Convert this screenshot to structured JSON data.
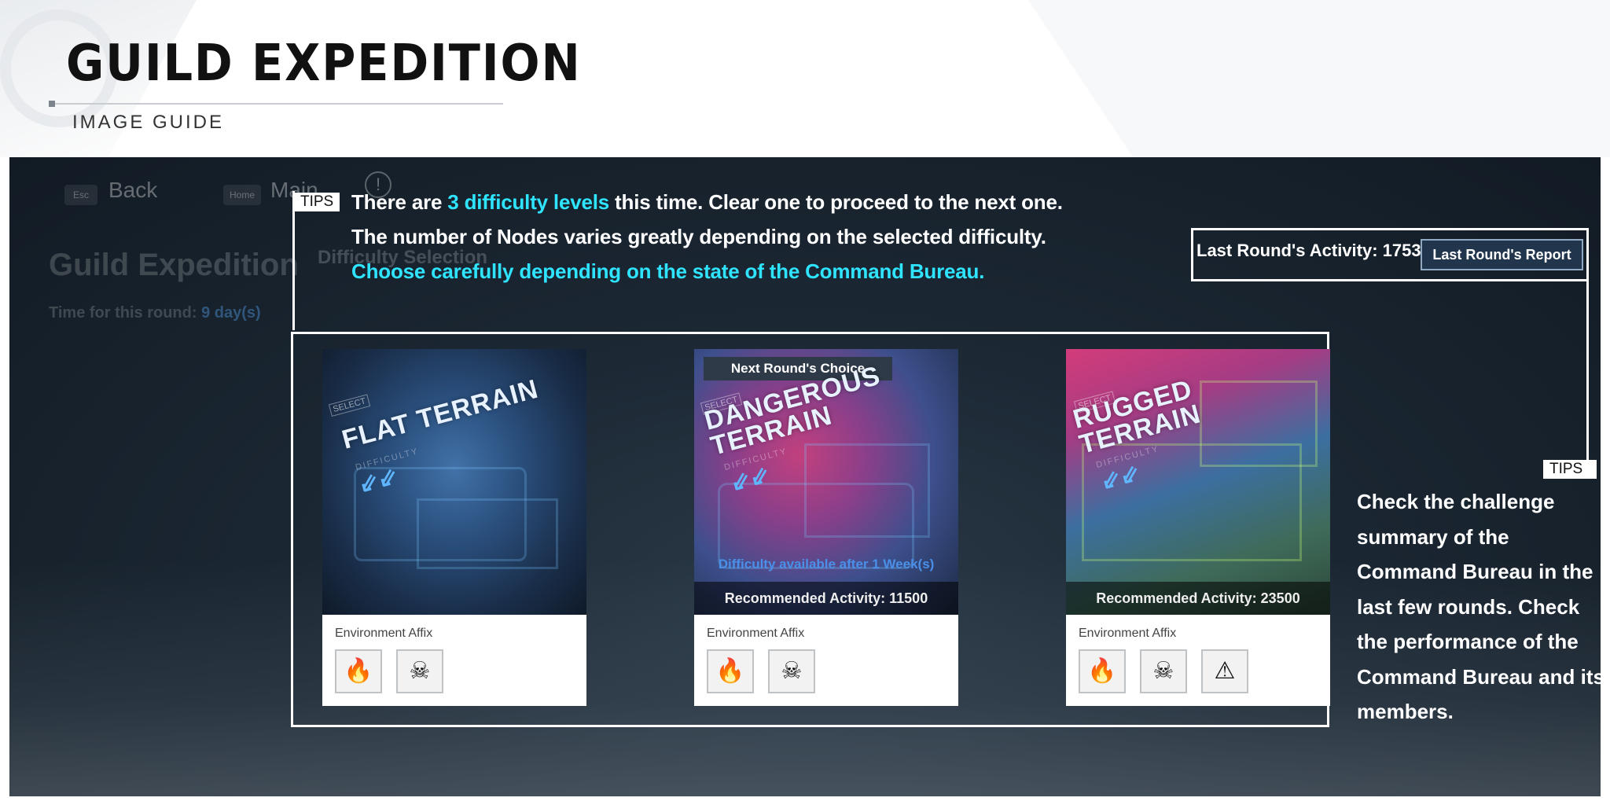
{
  "guide": {
    "title": "GUILD EXPEDITION",
    "subtitle": "IMAGE GUIDE"
  },
  "game_ui": {
    "esc_key": "Esc",
    "back_label": "Back",
    "home_key": "Home",
    "main_label": "Main",
    "info_icon": "!",
    "screen_title": "Guild Expedition",
    "time_label": "Time for this round:",
    "time_value": "9 day(s)",
    "section_label": "Difficulty Selection"
  },
  "tips": {
    "tag": "TIPS",
    "line1_pre": "There are ",
    "line1_highlight": "3 difficulty levels",
    "line1_post": " this time. Clear one to proceed to the next one.",
    "line2": "The number of Nodes varies greatly depending on the selected difficulty.",
    "line3": "Choose carefully depending on the state of the Command Bureau.",
    "side_text": "Check the challenge summary of the Command Bureau in the last few rounds. Check the performance of the Command Bureau and its members."
  },
  "last_round": {
    "activity_text": "Last Round's Activity: 1753",
    "report_button": "Last Round's Report"
  },
  "cards": [
    {
      "select_tag": "SELECT",
      "name_line1": "FLAT TERRAIN",
      "name_line2": "",
      "difficulty_word": "DIFFICULTY",
      "arrows": "⇙⇙",
      "recommended": "",
      "env_label": "Environment Affix",
      "affixes": [
        "fire-icon",
        "beast-icon"
      ]
    },
    {
      "badge": "Next Round's Choice",
      "select_tag": "SELECT",
      "name_line1": "DANGEROUS",
      "name_line2": "TERRAIN",
      "difficulty_word": "DIFFICULTY",
      "arrows": "⇙⇙",
      "availability": "Difficulty available after 1 Week(s)",
      "recommended": "Recommended Activity: 11500",
      "env_label": "Environment Affix",
      "affixes": [
        "fire-icon",
        "beast-icon"
      ]
    },
    {
      "select_tag": "SELECT",
      "name_line1": "RUGGED",
      "name_line2": "TERRAIN",
      "difficulty_word": "DIFFICULTY",
      "arrows": "⇙⇙",
      "recommended": "Recommended Activity: 23500",
      "env_label": "Environment Affix",
      "affixes": [
        "fire-icon",
        "beast-icon",
        "skull-warning-icon"
      ]
    }
  ],
  "colors": {
    "highlight": "#2fe4ff",
    "button_bg": "#21364d"
  }
}
